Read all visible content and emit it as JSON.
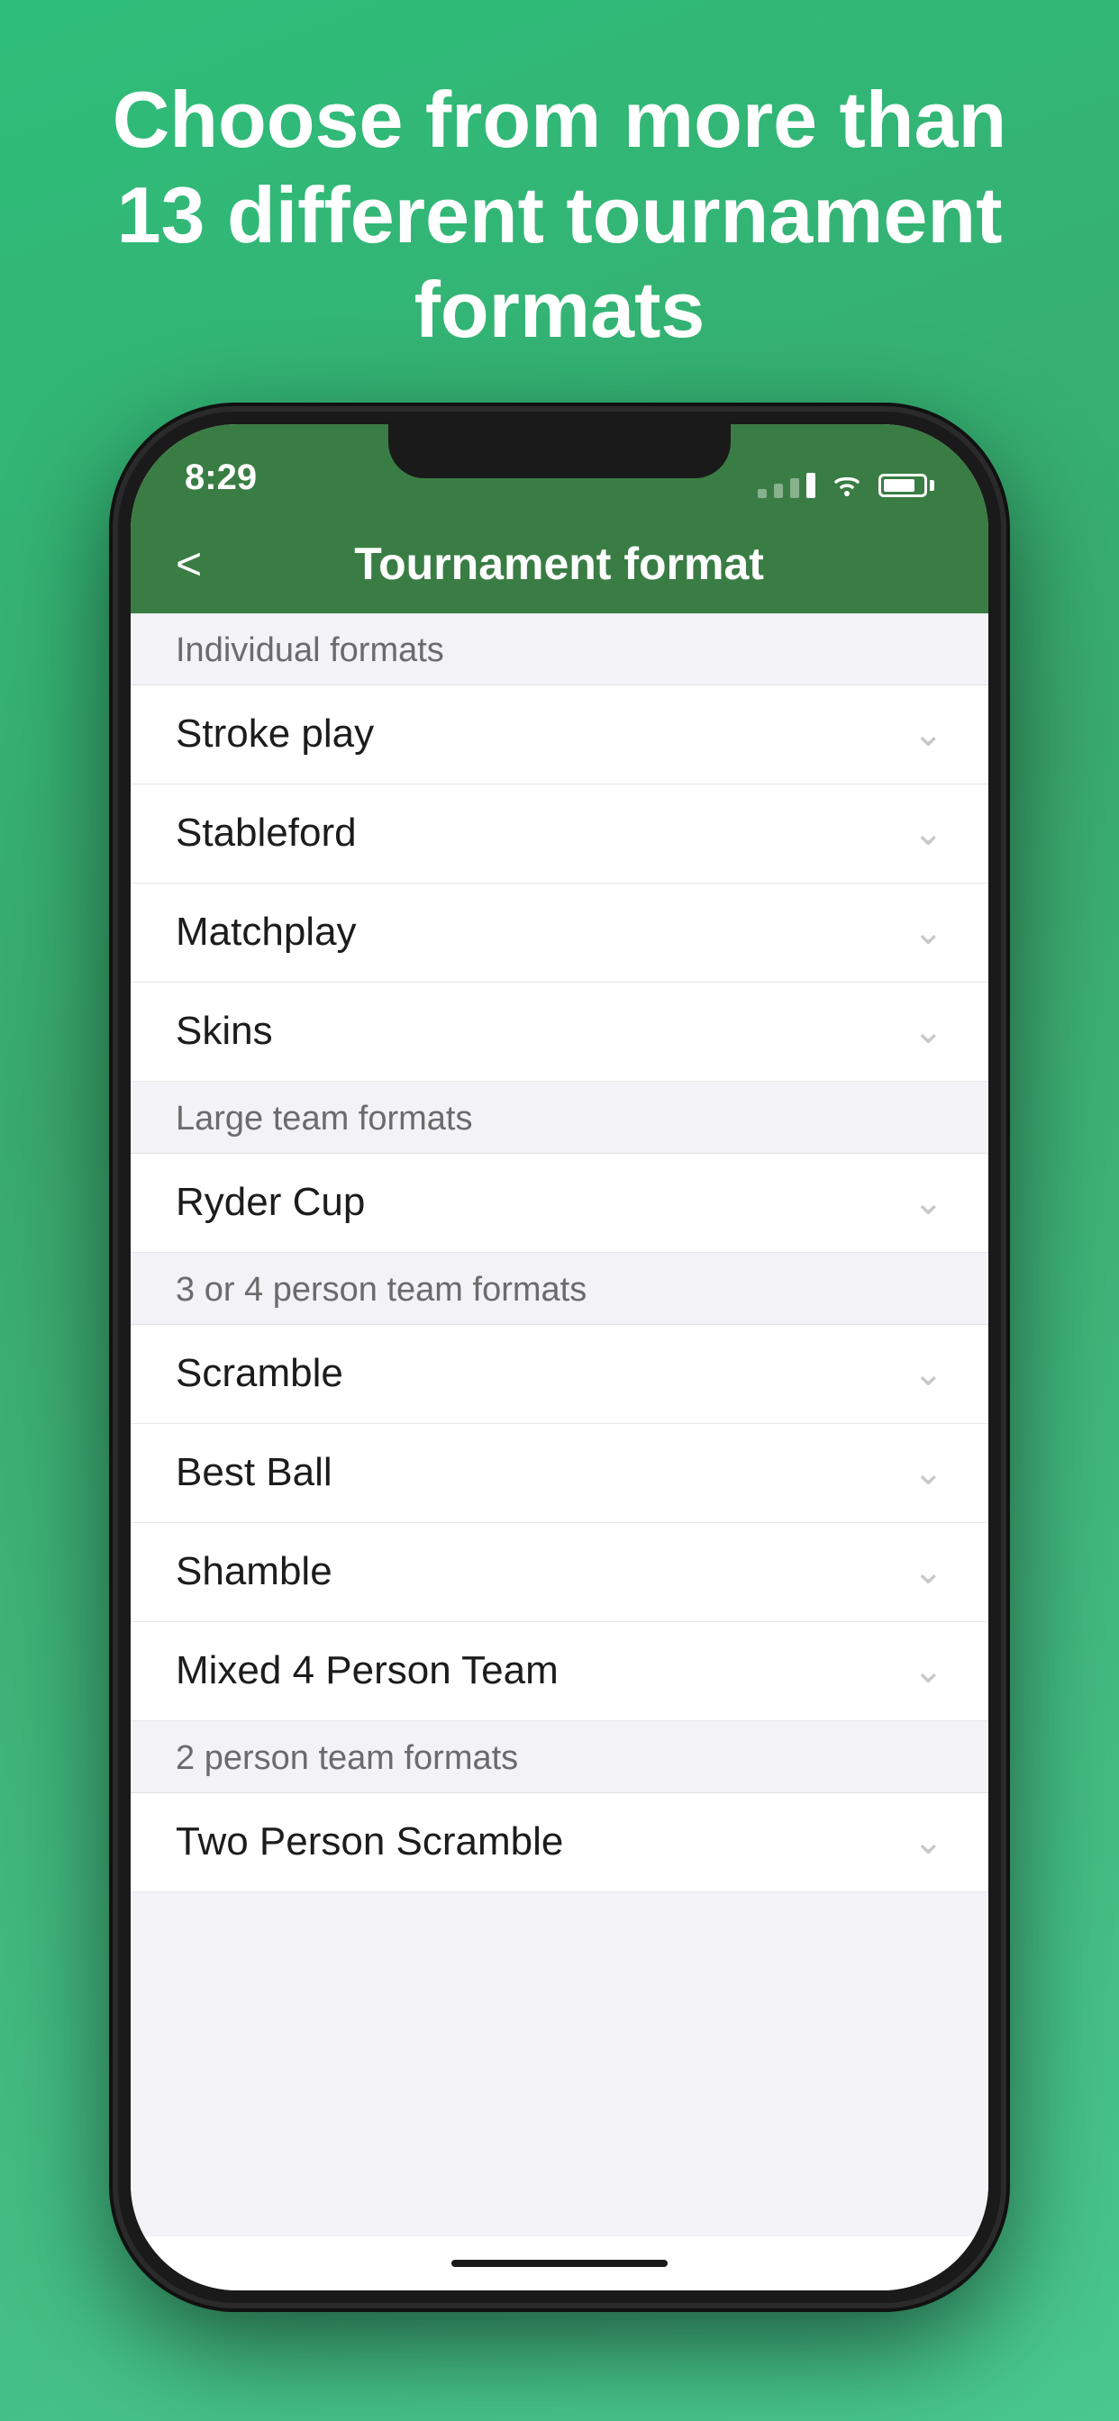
{
  "hero": {
    "text": "Choose from more than 13 different tournament formats"
  },
  "statusBar": {
    "time": "8:29"
  },
  "navBar": {
    "backLabel": "<",
    "title": "Tournament format"
  },
  "sections": [
    {
      "id": "individual",
      "header": "Individual formats",
      "items": [
        {
          "id": "stroke-play",
          "label": "Stroke play"
        },
        {
          "id": "stableford",
          "label": "Stableford"
        },
        {
          "id": "matchplay",
          "label": "Matchplay"
        },
        {
          "id": "skins",
          "label": "Skins"
        }
      ]
    },
    {
      "id": "large-team",
      "header": "Large team formats",
      "items": [
        {
          "id": "ryder-cup",
          "label": "Ryder Cup"
        }
      ]
    },
    {
      "id": "3or4-team",
      "header": "3 or 4 person team formats",
      "items": [
        {
          "id": "scramble",
          "label": "Scramble"
        },
        {
          "id": "best-ball",
          "label": "Best Ball"
        },
        {
          "id": "shamble",
          "label": "Shamble"
        },
        {
          "id": "mixed-4-person",
          "label": "Mixed 4 Person Team"
        }
      ]
    },
    {
      "id": "2person-team",
      "header": "2 person team formats",
      "items": [
        {
          "id": "two-person-scramble",
          "label": "Two Person Scramble"
        }
      ]
    }
  ]
}
